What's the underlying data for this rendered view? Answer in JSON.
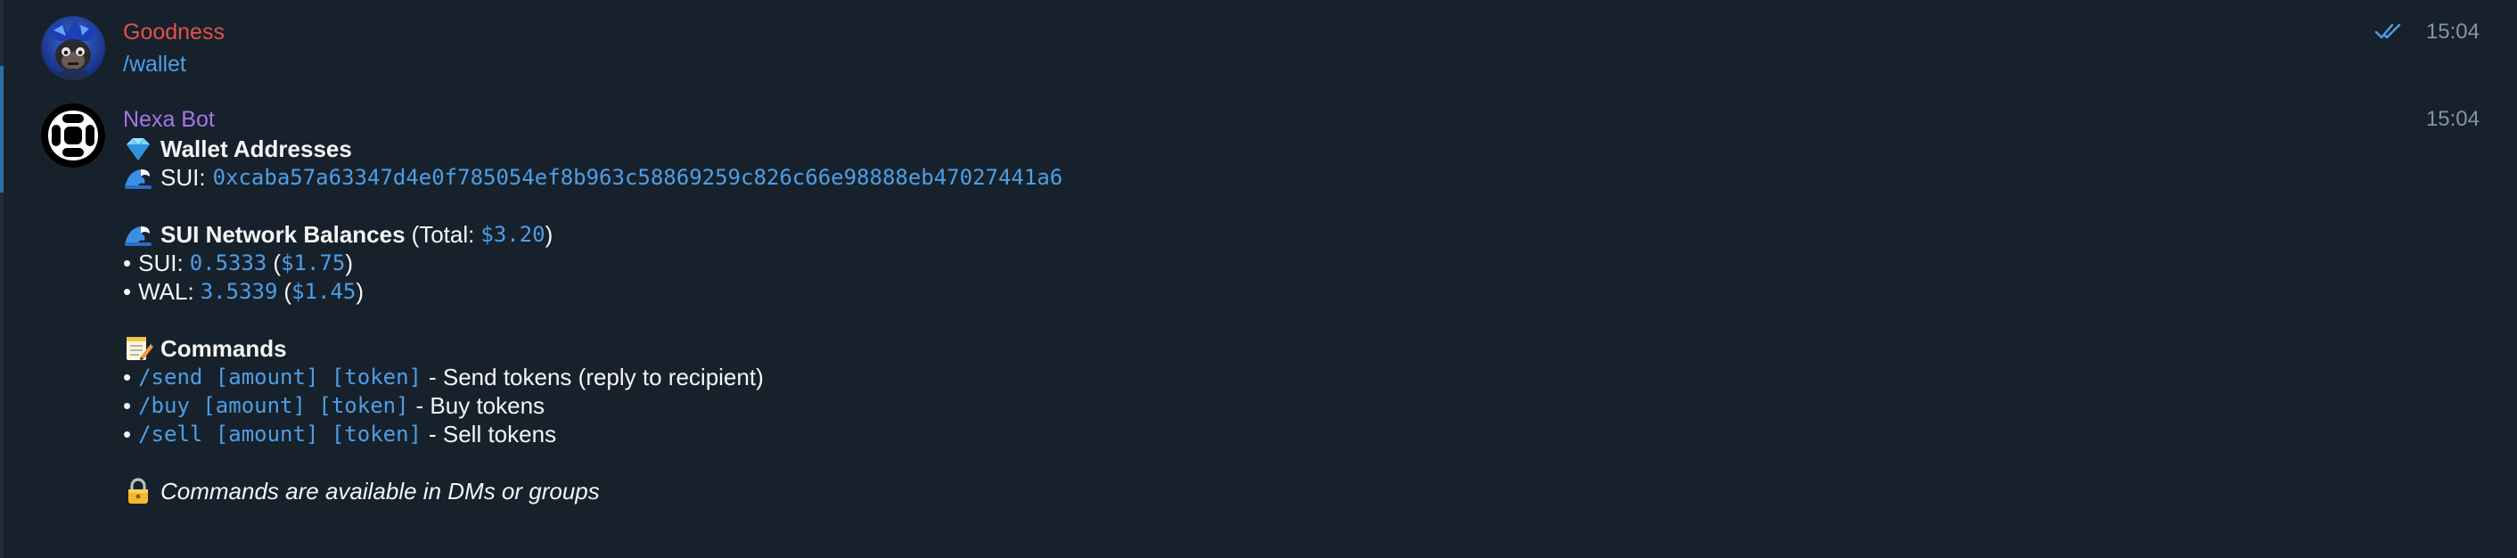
{
  "messages": [
    {
      "sender": "Goodness",
      "text": "/wallet",
      "time": "15:04",
      "status_icon": "double-check-icon"
    },
    {
      "sender": "Nexa Bot",
      "time": "15:04",
      "wallet_header": "Wallet Addresses",
      "sui_label": "SUI:",
      "sui_address": "0xcaba57a63347d4e0f785054ef8b963c58869259c826c66e98888eb47027441a6",
      "balances_header": "SUI Network Balances",
      "total_prefix": "(Total:",
      "total_value": "$3.20",
      "total_suffix": ")",
      "balances": [
        {
          "bullet": "•",
          "token": "SUI:",
          "amount": "0.5333",
          "open": "(",
          "usd": "$1.75",
          "close": ")"
        },
        {
          "bullet": "•",
          "token": "WAL:",
          "amount": "3.5339",
          "open": "(",
          "usd": "$1.45",
          "close": ")"
        }
      ],
      "commands_header": "Commands",
      "commands": [
        {
          "bullet": "•",
          "command": "/send [amount] [token]",
          "description": "- Send tokens (reply to recipient)"
        },
        {
          "bullet": "•",
          "command": "/buy [amount] [token]",
          "description": "- Buy tokens"
        },
        {
          "bullet": "•",
          "command": "/sell [amount] [token]",
          "description": "- Sell tokens"
        }
      ],
      "footer_note": "Commands are available in DMs or groups"
    }
  ],
  "icons": {
    "wallet_header": "gem-icon",
    "sui_address": "wave-icon",
    "balances_header": "wave-icon",
    "commands_header": "memo-icon",
    "footer_note": "lock-icon"
  },
  "colors": {
    "background": "#17212b",
    "link": "#4d9ee6",
    "sender_user": "#e0514f",
    "sender_bot": "#a773e8",
    "time": "#8494a3"
  }
}
